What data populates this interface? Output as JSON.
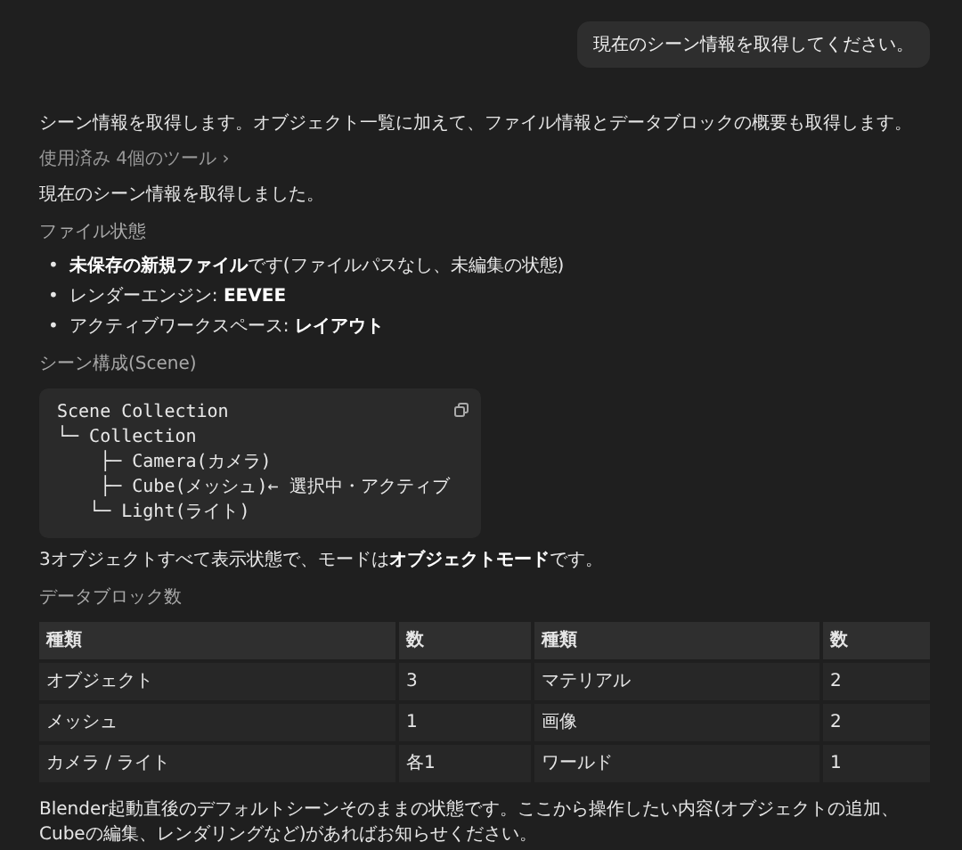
{
  "user_message": "現在のシーン情報を取得してください。",
  "intro": "シーン情報を取得します。オブジェクト一覧に加えて、ファイル情報とデータブロックの概要も取得します。",
  "tools_used": {
    "label": "使用済み 4個のツール",
    "chevron": "›"
  },
  "result": "現在のシーン情報を取得しました。",
  "file_heading": "ファイル状態",
  "bullet_marker": "•",
  "bullets": [
    "**未保存の新規ファイル**です(ファイルパスなし、未編集の状態)",
    "レンダーエンジン: **EEVEE**",
    "アクティブワークスペース: **レイアウト**"
  ],
  "scene_heading": "シーン構成(Scene)",
  "code_lines": [
    "Scene Collection",
    "└─ Collection",
    "    ├─ Camera(カメラ)",
    "    ├─ Cube(メッシュ)← 選択中・アクティブ",
    "   └─ Light(ライト)"
  ],
  "summary": "3オブジェクトすべて表示状態で、モードは**オブジェクトモード**です。",
  "datablock_heading": "データブロック数",
  "table": {
    "columns": [
      "種類",
      "数",
      "種類",
      "数"
    ],
    "rows": [
      [
        "オブジェクト",
        "3",
        "マテリアル",
        "2"
      ],
      [
        "メッシュ",
        "1",
        "画像",
        "2"
      ],
      [
        "カメラ / ライト",
        "各1",
        "ワールド",
        "1"
      ]
    ]
  },
  "closing": "Blender起動直後のデフォルトシーンそのままの状態です。ここから操作したい内容(オブジェクトの追加、Cubeの編集、レンダリングなど)があればお知らせください。"
}
